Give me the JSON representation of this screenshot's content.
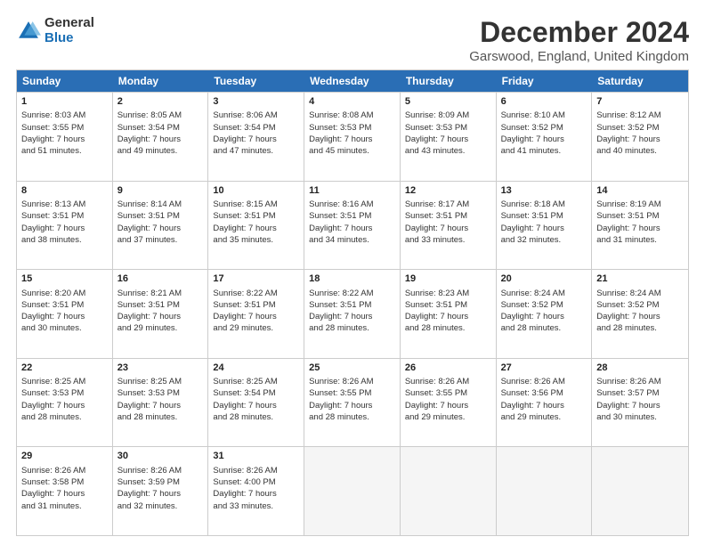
{
  "logo": {
    "general": "General",
    "blue": "Blue"
  },
  "title": "December 2024",
  "subtitle": "Garswood, England, United Kingdom",
  "header": {
    "days": [
      "Sunday",
      "Monday",
      "Tuesday",
      "Wednesday",
      "Thursday",
      "Friday",
      "Saturday"
    ]
  },
  "weeks": [
    [
      {
        "day": "1",
        "lines": [
          "Sunrise: 8:03 AM",
          "Sunset: 3:55 PM",
          "Daylight: 7 hours",
          "and 51 minutes."
        ]
      },
      {
        "day": "2",
        "lines": [
          "Sunrise: 8:05 AM",
          "Sunset: 3:54 PM",
          "Daylight: 7 hours",
          "and 49 minutes."
        ]
      },
      {
        "day": "3",
        "lines": [
          "Sunrise: 8:06 AM",
          "Sunset: 3:54 PM",
          "Daylight: 7 hours",
          "and 47 minutes."
        ]
      },
      {
        "day": "4",
        "lines": [
          "Sunrise: 8:08 AM",
          "Sunset: 3:53 PM",
          "Daylight: 7 hours",
          "and 45 minutes."
        ]
      },
      {
        "day": "5",
        "lines": [
          "Sunrise: 8:09 AM",
          "Sunset: 3:53 PM",
          "Daylight: 7 hours",
          "and 43 minutes."
        ]
      },
      {
        "day": "6",
        "lines": [
          "Sunrise: 8:10 AM",
          "Sunset: 3:52 PM",
          "Daylight: 7 hours",
          "and 41 minutes."
        ]
      },
      {
        "day": "7",
        "lines": [
          "Sunrise: 8:12 AM",
          "Sunset: 3:52 PM",
          "Daylight: 7 hours",
          "and 40 minutes."
        ]
      }
    ],
    [
      {
        "day": "8",
        "lines": [
          "Sunrise: 8:13 AM",
          "Sunset: 3:51 PM",
          "Daylight: 7 hours",
          "and 38 minutes."
        ]
      },
      {
        "day": "9",
        "lines": [
          "Sunrise: 8:14 AM",
          "Sunset: 3:51 PM",
          "Daylight: 7 hours",
          "and 37 minutes."
        ]
      },
      {
        "day": "10",
        "lines": [
          "Sunrise: 8:15 AM",
          "Sunset: 3:51 PM",
          "Daylight: 7 hours",
          "and 35 minutes."
        ]
      },
      {
        "day": "11",
        "lines": [
          "Sunrise: 8:16 AM",
          "Sunset: 3:51 PM",
          "Daylight: 7 hours",
          "and 34 minutes."
        ]
      },
      {
        "day": "12",
        "lines": [
          "Sunrise: 8:17 AM",
          "Sunset: 3:51 PM",
          "Daylight: 7 hours",
          "and 33 minutes."
        ]
      },
      {
        "day": "13",
        "lines": [
          "Sunrise: 8:18 AM",
          "Sunset: 3:51 PM",
          "Daylight: 7 hours",
          "and 32 minutes."
        ]
      },
      {
        "day": "14",
        "lines": [
          "Sunrise: 8:19 AM",
          "Sunset: 3:51 PM",
          "Daylight: 7 hours",
          "and 31 minutes."
        ]
      }
    ],
    [
      {
        "day": "15",
        "lines": [
          "Sunrise: 8:20 AM",
          "Sunset: 3:51 PM",
          "Daylight: 7 hours",
          "and 30 minutes."
        ]
      },
      {
        "day": "16",
        "lines": [
          "Sunrise: 8:21 AM",
          "Sunset: 3:51 PM",
          "Daylight: 7 hours",
          "and 29 minutes."
        ]
      },
      {
        "day": "17",
        "lines": [
          "Sunrise: 8:22 AM",
          "Sunset: 3:51 PM",
          "Daylight: 7 hours",
          "and 29 minutes."
        ]
      },
      {
        "day": "18",
        "lines": [
          "Sunrise: 8:22 AM",
          "Sunset: 3:51 PM",
          "Daylight: 7 hours",
          "and 28 minutes."
        ]
      },
      {
        "day": "19",
        "lines": [
          "Sunrise: 8:23 AM",
          "Sunset: 3:51 PM",
          "Daylight: 7 hours",
          "and 28 minutes."
        ]
      },
      {
        "day": "20",
        "lines": [
          "Sunrise: 8:24 AM",
          "Sunset: 3:52 PM",
          "Daylight: 7 hours",
          "and 28 minutes."
        ]
      },
      {
        "day": "21",
        "lines": [
          "Sunrise: 8:24 AM",
          "Sunset: 3:52 PM",
          "Daylight: 7 hours",
          "and 28 minutes."
        ]
      }
    ],
    [
      {
        "day": "22",
        "lines": [
          "Sunrise: 8:25 AM",
          "Sunset: 3:53 PM",
          "Daylight: 7 hours",
          "and 28 minutes."
        ]
      },
      {
        "day": "23",
        "lines": [
          "Sunrise: 8:25 AM",
          "Sunset: 3:53 PM",
          "Daylight: 7 hours",
          "and 28 minutes."
        ]
      },
      {
        "day": "24",
        "lines": [
          "Sunrise: 8:25 AM",
          "Sunset: 3:54 PM",
          "Daylight: 7 hours",
          "and 28 minutes."
        ]
      },
      {
        "day": "25",
        "lines": [
          "Sunrise: 8:26 AM",
          "Sunset: 3:55 PM",
          "Daylight: 7 hours",
          "and 28 minutes."
        ]
      },
      {
        "day": "26",
        "lines": [
          "Sunrise: 8:26 AM",
          "Sunset: 3:55 PM",
          "Daylight: 7 hours",
          "and 29 minutes."
        ]
      },
      {
        "day": "27",
        "lines": [
          "Sunrise: 8:26 AM",
          "Sunset: 3:56 PM",
          "Daylight: 7 hours",
          "and 29 minutes."
        ]
      },
      {
        "day": "28",
        "lines": [
          "Sunrise: 8:26 AM",
          "Sunset: 3:57 PM",
          "Daylight: 7 hours",
          "and 30 minutes."
        ]
      }
    ],
    [
      {
        "day": "29",
        "lines": [
          "Sunrise: 8:26 AM",
          "Sunset: 3:58 PM",
          "Daylight: 7 hours",
          "and 31 minutes."
        ]
      },
      {
        "day": "30",
        "lines": [
          "Sunrise: 8:26 AM",
          "Sunset: 3:59 PM",
          "Daylight: 7 hours",
          "and 32 minutes."
        ]
      },
      {
        "day": "31",
        "lines": [
          "Sunrise: 8:26 AM",
          "Sunset: 4:00 PM",
          "Daylight: 7 hours",
          "and 33 minutes."
        ]
      },
      {
        "day": "",
        "lines": []
      },
      {
        "day": "",
        "lines": []
      },
      {
        "day": "",
        "lines": []
      },
      {
        "day": "",
        "lines": []
      }
    ]
  ]
}
